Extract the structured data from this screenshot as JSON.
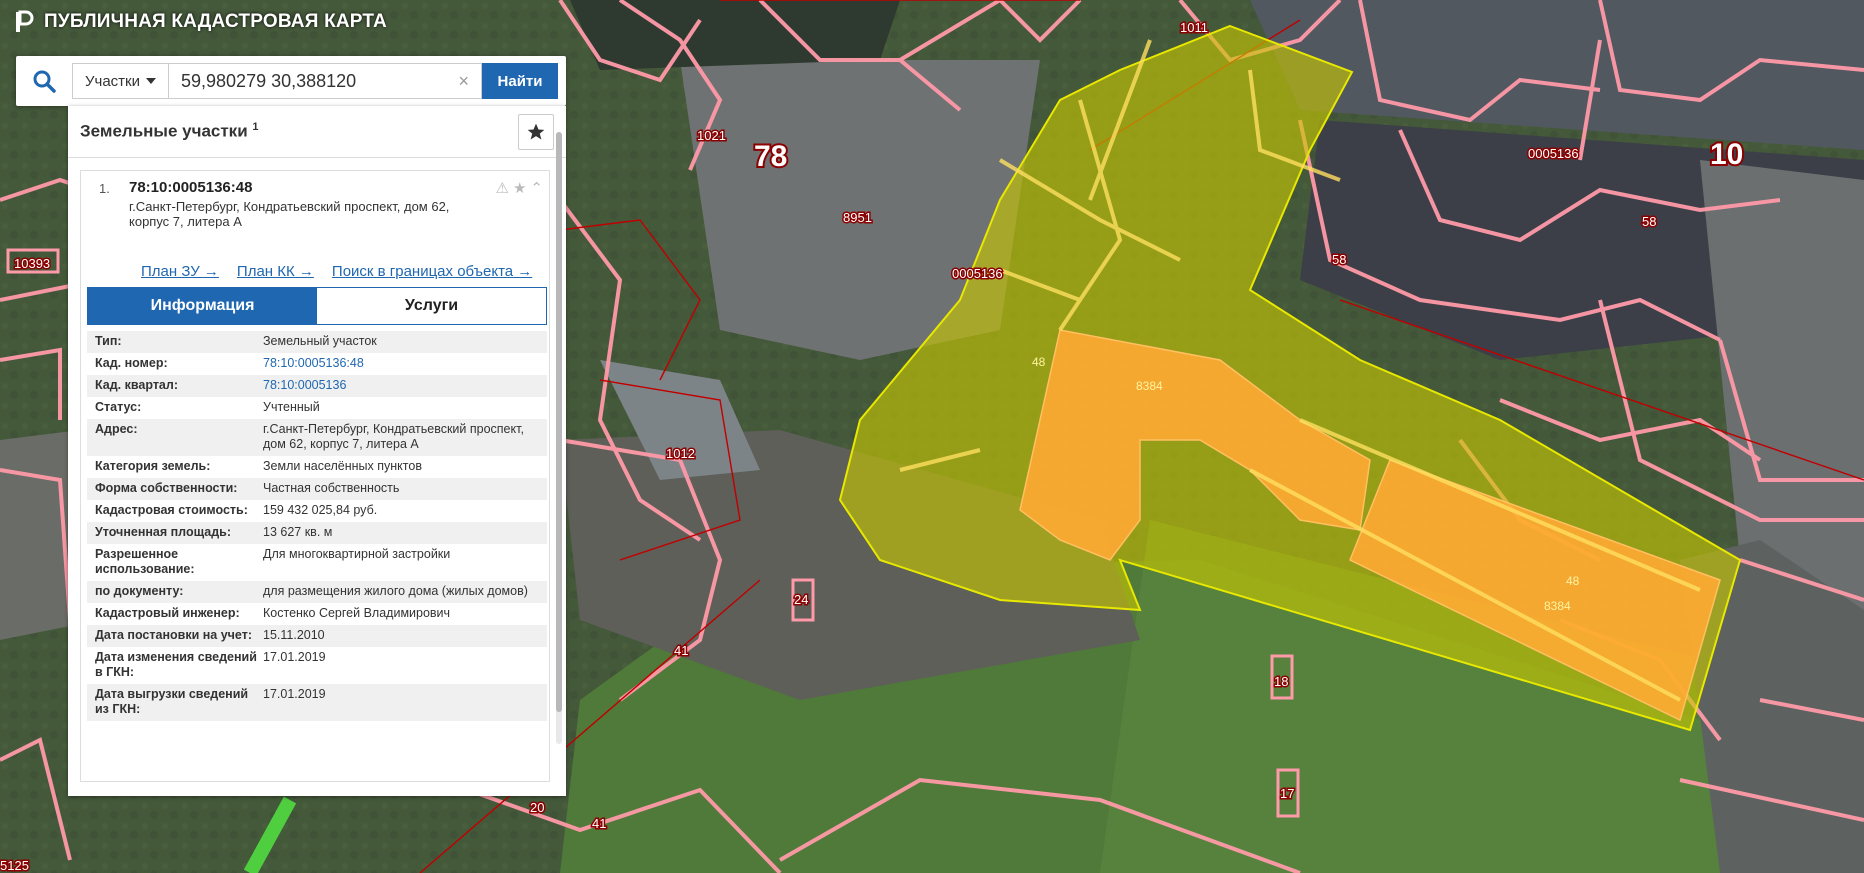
{
  "app": {
    "title": "ПУБЛИЧНАЯ КАДАСТРОВАЯ КАРТА"
  },
  "search": {
    "type_label": "Участки",
    "query": "59,980279 30,388120",
    "submit_label": "Найти",
    "clear_glyph": "×"
  },
  "panel": {
    "title": "Земельные участки",
    "count": "1"
  },
  "result": {
    "number": "1.",
    "cad_number": "78:10:0005136:48",
    "address": "г.Санкт-Петербург, Кондратьевский проспект, дом 62, корпус 7, литера А",
    "links": [
      "План ЗУ →",
      "План КК →",
      "Поиск в границах объекта →"
    ],
    "tabs": {
      "info": "Информация",
      "services": "Услуги"
    },
    "info_rows": [
      {
        "key": "Тип:",
        "value": "Земельный участок",
        "link": false
      },
      {
        "key": "Кад. номер:",
        "value": "78:10:0005136:48",
        "link": true
      },
      {
        "key": "Кад. квартал:",
        "value": "78:10:0005136",
        "link": true
      },
      {
        "key": "Статус:",
        "value": "Учтенный",
        "link": false
      },
      {
        "key": "Адрес:",
        "value": "г.Санкт-Петербург, Кондратьевский проспект, дом 62, корпус 7, литера А",
        "link": false
      },
      {
        "key": "Категория земель:",
        "value": "Земли населённых пунктов",
        "link": false
      },
      {
        "key": "Форма собственности:",
        "value": "Частная собственность",
        "link": false
      },
      {
        "key": "Кадастровая стоимость:",
        "value": "159 432 025,84 руб.",
        "link": false
      },
      {
        "key": "Уточненная площадь:",
        "value": "13 627 кв. м",
        "link": false
      },
      {
        "key": "Разрешенное использование:",
        "value": "Для многоквартирной застройки",
        "link": false
      },
      {
        "key": "по документу:",
        "value": "для размещения жилого дома (жилых домов)",
        "link": false
      },
      {
        "key": "Кадастровый инженер:",
        "value": "Костенко Сергей Владимирович",
        "link": false
      },
      {
        "key": "Дата постановки на учет:",
        "value": "15.11.2010",
        "link": false
      },
      {
        "key": "Дата изменения сведений в ГКН:",
        "value": "17.01.2019",
        "link": false
      },
      {
        "key": "Дата выгрузки сведений из ГКН:",
        "value": "17.01.2019",
        "link": false
      }
    ]
  },
  "map": {
    "labels": {
      "l1011": "1011",
      "l1021": "1021",
      "l78": "78",
      "l8951": "8951",
      "l0005136a": "0005136",
      "l0005136b": "0005136",
      "l10": "10",
      "l58a": "58",
      "l58b": "58",
      "l10393": "10393",
      "l1012": "1012",
      "l48a": "48",
      "l8384a": "8384",
      "l48b": "48",
      "l8384b": "8384",
      "l41a": "41",
      "l41b": "41",
      "l20": "20",
      "l125": "5125",
      "l18": "18",
      "l24": "24",
      "l17": "17"
    }
  },
  "colors": {
    "accent": "#1f67b1",
    "parcel_highlight": "#c8c800",
    "building": "#ffaa33",
    "boundary": "#ff9aa8"
  }
}
